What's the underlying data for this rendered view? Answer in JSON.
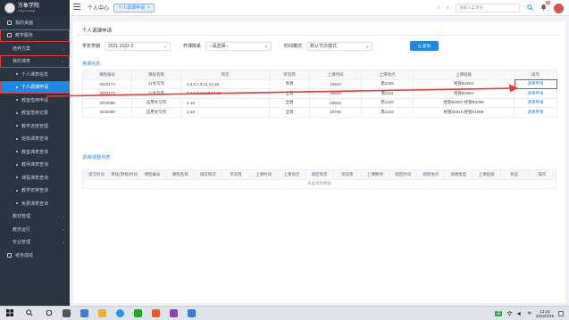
{
  "sidebar": {
    "logo_title": "万象学院",
    "logo_subtitle": "Image College",
    "items": [
      {
        "label": "我的桌面",
        "level": 1
      },
      {
        "label": "教学服务",
        "level": 1
      },
      {
        "label": "培养方案",
        "level": 2
      },
      {
        "label": "我的课表",
        "level": 2
      },
      {
        "label": "个人课表信息",
        "level": 3
      },
      {
        "label": "个人调课申请",
        "level": 3
      },
      {
        "label": "教室借用申请",
        "level": 3
      },
      {
        "label": "教室借用记录",
        "level": 3
      },
      {
        "label": "教学进度管理",
        "level": 3
      },
      {
        "label": "班级课表查询",
        "level": 3
      },
      {
        "label": "教室课表查询",
        "level": 3
      },
      {
        "label": "教师课表查询",
        "level": 3
      },
      {
        "label": "课程课表查询",
        "level": 3
      },
      {
        "label": "教学安排查询",
        "level": 3
      },
      {
        "label": "免费课表查询",
        "level": 3
      },
      {
        "label": "教材管理",
        "level": 2
      },
      {
        "label": "教务运行",
        "level": 2
      },
      {
        "label": "专业管理",
        "level": 2
      },
      {
        "label": "考务成绩",
        "level": 1
      }
    ]
  },
  "topbar": {
    "crumb": "个人中心",
    "tab_label": "个人调课申请",
    "search_placeholder": "请输入菜单名",
    "notification_count": "4"
  },
  "panel": {
    "title": "个人调课申请",
    "filters": {
      "year_label": "学年学期",
      "year_value": "2021-2022-2",
      "dept_label": "开课院系",
      "dept_value": "--请选择--",
      "mode_label": "时间模式",
      "mode_value": "默认节次模式"
    },
    "query_button": "Q 查询",
    "schedule_section": "排课信息:",
    "schedule_headers": [
      "课程编号",
      "课程名称",
      "周次",
      "单双周",
      "上课时间",
      "上课地点",
      "上课班级",
      "操作"
    ],
    "schedule_rows": [
      [
        "3310173",
        "公文写作",
        "1,3,5,7,9,11,13,15",
        "单周",
        "10910",
        "南2205",
        "经管B1904",
        "调课申请"
      ],
      [
        "3310173",
        "公文写作",
        "2,4,6,8,10,12,14,16",
        "全周",
        "20910",
        "南2111",
        "经管B1904",
        "调课申请"
      ],
      [
        "3010088",
        "应用文写作",
        "1-16",
        "全周",
        "10910",
        "南1222",
        "经管B2007,经管B2089",
        "调课申请"
      ],
      [
        "3010088",
        "应用文写作",
        "1-16",
        "全周",
        "10708",
        "南1223",
        "经管Z1910,经管Z1989",
        "调课申请"
      ]
    ],
    "record_section": "调课/调整列表:",
    "record_headers": [
      "提交时间",
      "审核(审核)时间",
      "课程编号",
      "课程名称",
      "调前周次",
      "单双周",
      "上课时间",
      "上课地点",
      "调后周次",
      "单双周",
      "上课教师",
      "调后时间",
      "调后地点",
      "调课类型",
      "上课班级",
      "状态",
      "操作"
    ],
    "record_empty": "未查询到数据"
  },
  "taskbar": {
    "time": "13:20",
    "date": "2022/3/15",
    "lang": "中",
    "weather": "天"
  }
}
